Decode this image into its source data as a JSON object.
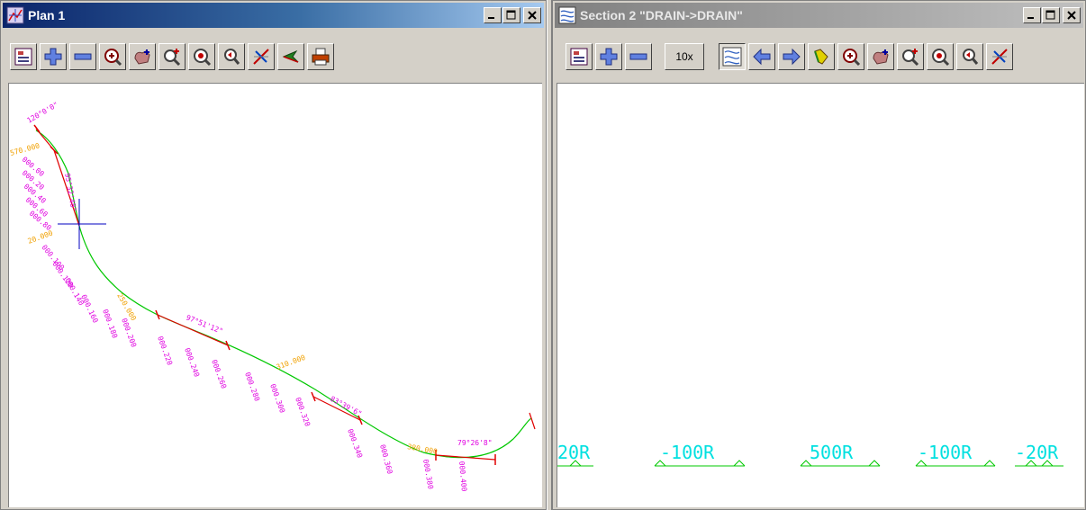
{
  "plan_window": {
    "title": "Plan 1",
    "toolbar": [
      "plot-icon",
      "zoom-in-icon",
      "zoom-out-icon",
      "zoom-fit-icon",
      "pan-icon",
      "zoom-window-icon",
      "zoom-center-icon",
      "zoom-previous-icon",
      "cross-section-icon",
      "measure-icon",
      "print-icon"
    ],
    "labels": {
      "pink": [
        "120°0'0\"",
        "95°32'48\"",
        "97°51'12\"",
        "83°39'6\"",
        "79°26'8\""
      ],
      "numbers": [
        "000.00",
        "000.20",
        "000.40",
        "000.60",
        "000.80",
        "000.100",
        "000.120",
        "000.140",
        "000.160",
        "000.180",
        "000.200",
        "000.220",
        "000.240",
        "000.260",
        "000.280",
        "000.300",
        "000.320",
        "000.340",
        "000.360",
        "000.380",
        "000.400"
      ],
      "orange": [
        "570.000",
        "20.000",
        "250.000",
        "310.000",
        "380.000"
      ]
    }
  },
  "section_window": {
    "title": "Section 2 \"DRAIN->DRAIN\"",
    "scale_button": "10x",
    "toolbar": [
      "plot-icon",
      "zoom-in-icon",
      "zoom-out-icon",
      "scale-10x-button",
      "section-toggle-icon",
      "previous-section-icon",
      "next-section-icon",
      "pick-icon",
      "zoom-fit-icon",
      "pan-icon",
      "zoom-window-icon",
      "zoom-center-icon",
      "zoom-previous-icon",
      "cross-section-icon"
    ],
    "radius_labels": [
      "20R",
      "-100R",
      "500R",
      "-100R",
      "-20R"
    ]
  },
  "colors": {
    "title_active": "#0a246a",
    "road_line": "#00c800",
    "straight_line": "#e00000",
    "magenta_labels": "#e000e0",
    "orange_labels": "#f0a000",
    "cyan_text": "#00e0e0",
    "radius_markers": "#00c800"
  }
}
